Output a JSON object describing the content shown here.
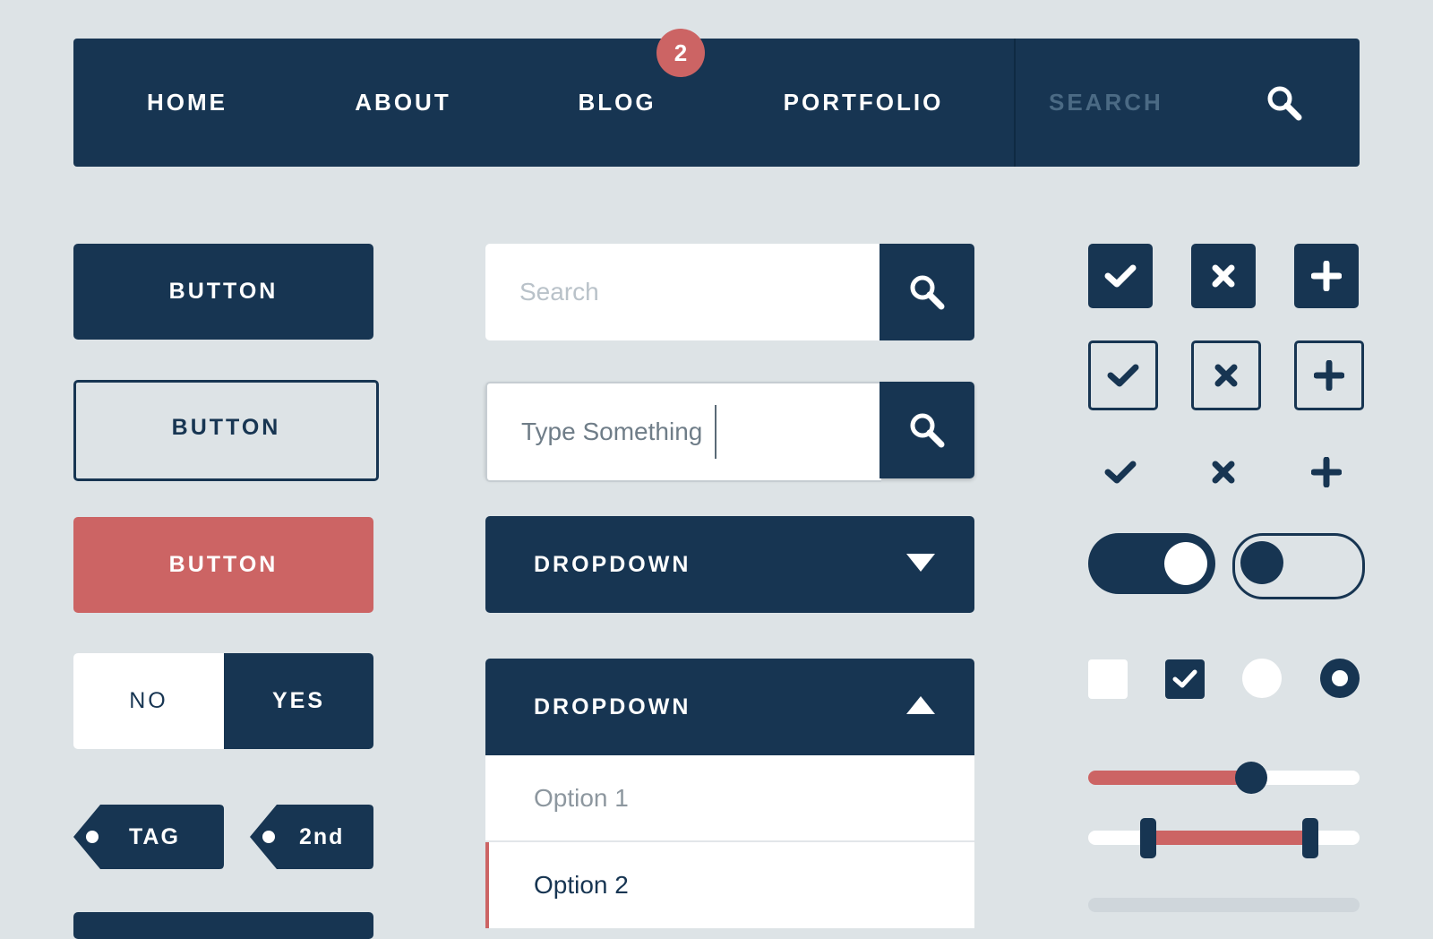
{
  "navbar": {
    "items": [
      {
        "label": "HOME"
      },
      {
        "label": "ABOUT"
      },
      {
        "label": "BLOG",
        "badge": "2"
      },
      {
        "label": "PORTFOLIO"
      }
    ],
    "search_placeholder": "SEARCH",
    "search_icon": "search-icon"
  },
  "buttons": {
    "primary_label": "BUTTON",
    "outline_label": "BUTTON",
    "danger_label": "BUTTON"
  },
  "toggle": {
    "no_label": "NO",
    "yes_label": "YES",
    "selected": "YES"
  },
  "tags": [
    {
      "label": "TAG"
    },
    {
      "label": "2nd"
    }
  ],
  "search_fields": [
    {
      "placeholder": "Search",
      "value": ""
    },
    {
      "placeholder": "",
      "value": "Type Something"
    }
  ],
  "dropdowns": [
    {
      "label": "DROPDOWN",
      "state": "collapsed",
      "icon": "caret-down-icon"
    },
    {
      "label": "DROPDOWN",
      "state": "expanded",
      "icon": "caret-up-icon",
      "options": [
        "Option 1",
        "Option 2"
      ],
      "selected": "Option 2"
    }
  ],
  "icon_grid": {
    "rows": [
      [
        "check-icon",
        "close-icon",
        "plus-icon"
      ],
      [
        "check-icon",
        "close-icon",
        "plus-icon"
      ],
      [
        "check-icon",
        "close-icon",
        "plus-icon"
      ]
    ]
  },
  "switches": [
    {
      "state": "on"
    },
    {
      "state": "off"
    }
  ],
  "checkboxes": [
    {
      "checked": false
    },
    {
      "checked": true
    }
  ],
  "radios": [
    {
      "selected": false
    },
    {
      "selected": true
    }
  ],
  "slider": {
    "value": 0.6
  },
  "range_slider": {
    "low": 0.22,
    "high": 0.82
  },
  "progress": {
    "value": 0
  },
  "colors": {
    "navy": "#173552",
    "accent": "#cc6464",
    "background": "#dde3e6",
    "white": "#ffffff"
  }
}
